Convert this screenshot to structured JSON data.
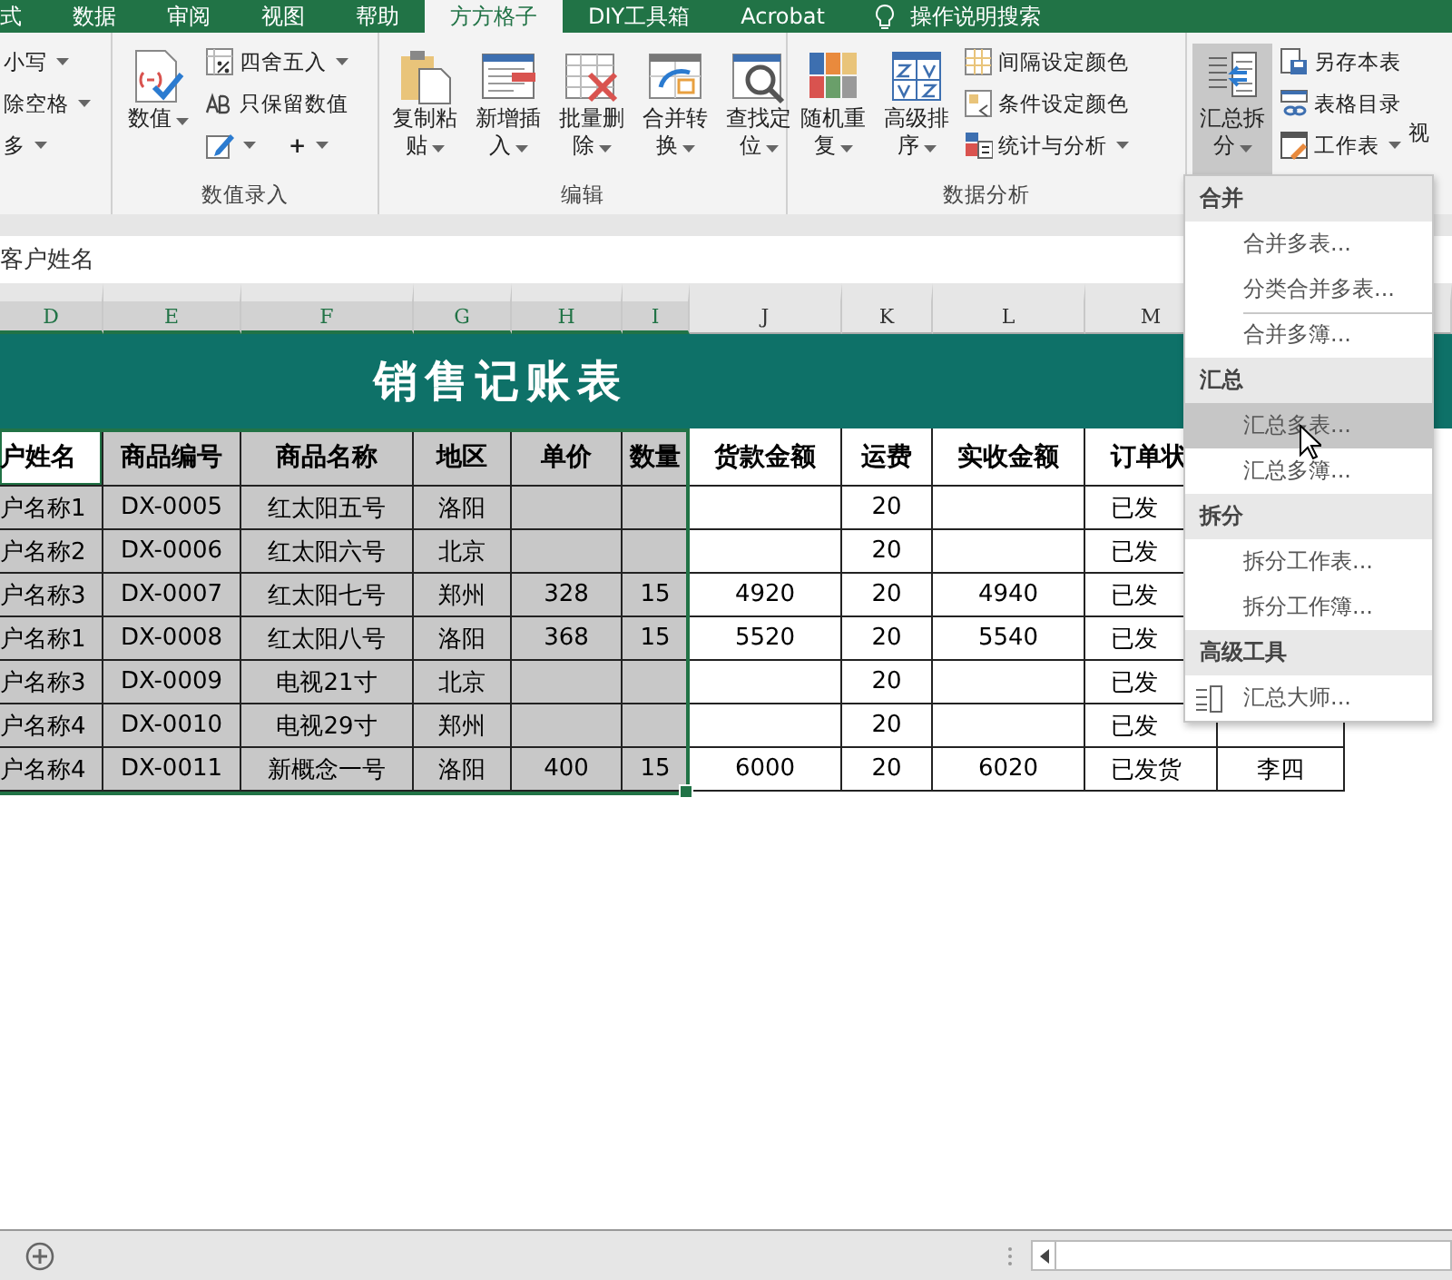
{
  "ribbon_tabs": [
    {
      "label": "式",
      "selected": false
    },
    {
      "label": "数据",
      "selected": false
    },
    {
      "label": "审阅",
      "selected": false
    },
    {
      "label": "视图",
      "selected": false
    },
    {
      "label": "帮助",
      "selected": false
    },
    {
      "label": "方方格子",
      "selected": true
    },
    {
      "label": "DIY工具箱",
      "selected": false
    },
    {
      "label": "Acrobat",
      "selected": false
    }
  ],
  "tell_me": "操作说明搜索",
  "ribbon": {
    "partial_group": {
      "items": [
        "小写",
        "除空格",
        "多"
      ]
    },
    "number_entry": {
      "label": "数值录入",
      "big": "数值",
      "small": [
        {
          "label": "四舍五入",
          "dropdown": true
        },
        {
          "label": "只保留数值",
          "dropdown": false
        }
      ],
      "plus": "+"
    },
    "edit": {
      "label": "编辑",
      "buttons": [
        "复制粘贴",
        "新增插入",
        "批量删除",
        "合并转换",
        "查找定位"
      ]
    },
    "analysis": {
      "label": "数据分析",
      "buttons": [
        "随机重复",
        "高级排序"
      ],
      "small": [
        {
          "label": "间隔设定颜色",
          "dropdown": false
        },
        {
          "label": "条件设定颜色",
          "dropdown": false
        },
        {
          "label": "统计与分析",
          "dropdown": true
        }
      ]
    },
    "summary": {
      "big": {
        "label": "汇总拆分",
        "pressed": true
      },
      "small": [
        {
          "label": "另存本表",
          "dropdown": false
        },
        {
          "label": "表格目录",
          "dropdown": false
        },
        {
          "label": "工作表",
          "dropdown": true
        }
      ]
    },
    "cut_tab": "视"
  },
  "formula_bar": {
    "value": "客户姓名"
  },
  "columns": [
    {
      "letter": "D",
      "selected": true
    },
    {
      "letter": "E",
      "selected": true
    },
    {
      "letter": "F",
      "selected": true
    },
    {
      "letter": "G",
      "selected": true
    },
    {
      "letter": "H",
      "selected": true
    },
    {
      "letter": "I",
      "selected": true
    },
    {
      "letter": "J",
      "selected": false
    },
    {
      "letter": "K",
      "selected": false
    },
    {
      "letter": "L",
      "selected": false
    },
    {
      "letter": "M",
      "selected": false
    }
  ],
  "sheet_title": "销售记账表",
  "table": {
    "headers": [
      {
        "text": "户姓名",
        "active": true
      },
      {
        "text": "商品编号",
        "active": false
      },
      {
        "text": "商品名称",
        "active": false
      },
      {
        "text": "地区",
        "active": false
      },
      {
        "text": "单价",
        "active": false
      },
      {
        "text": "数量",
        "active": false
      },
      {
        "text": "货款金额",
        "active": false
      },
      {
        "text": "运费",
        "active": false
      },
      {
        "text": "实收金额",
        "active": false
      },
      {
        "text": "订单状",
        "active": false
      }
    ],
    "rows": [
      [
        "户名称1",
        "DX-0005",
        "红太阳五号",
        "洛阳",
        null,
        null,
        null,
        "20",
        null,
        "已发",
        null
      ],
      [
        "户名称2",
        "DX-0006",
        "红太阳六号",
        "北京",
        null,
        null,
        null,
        "20",
        null,
        "已发",
        null
      ],
      [
        "户名称3",
        "DX-0007",
        "红太阳七号",
        "郑州",
        "328",
        "15",
        "4920",
        "20",
        "4940",
        "已发",
        null
      ],
      [
        "户名称1",
        "DX-0008",
        "红太阳八号",
        "洛阳",
        "368",
        "15",
        "5520",
        "20",
        "5540",
        "已发",
        null
      ],
      [
        "户名称3",
        "DX-0009",
        "电视21寸",
        "北京",
        null,
        null,
        null,
        "20",
        null,
        "已发",
        null
      ],
      [
        "户名称4",
        "DX-0010",
        "电视29寸",
        "郑州",
        null,
        null,
        null,
        "20",
        null,
        "已发",
        null
      ],
      [
        "户名称4",
        "DX-0011",
        "新概念一号",
        "洛阳",
        "400",
        "15",
        "6000",
        "20",
        "6020",
        "已发货",
        "李四"
      ]
    ]
  },
  "dropdown_menu": {
    "sections": [
      {
        "title": "合并",
        "items": [
          {
            "label": "合并多表...",
            "highlighted": false,
            "separator_before": false,
            "has_icon": false
          },
          {
            "label": "分类合并多表...",
            "highlighted": false,
            "separator_before": false,
            "has_icon": false
          },
          {
            "label": "合并多簿...",
            "highlighted": false,
            "separator_before": true,
            "has_icon": false
          }
        ]
      },
      {
        "title": "汇总",
        "items": [
          {
            "label": "汇总多表...",
            "highlighted": true,
            "separator_before": false,
            "has_icon": false
          },
          {
            "label": "汇总多簿...",
            "highlighted": false,
            "separator_before": false,
            "has_icon": false
          }
        ]
      },
      {
        "title": "拆分",
        "items": [
          {
            "label": "拆分工作表...",
            "highlighted": false,
            "separator_before": false,
            "has_icon": false
          },
          {
            "label": "拆分工作簿...",
            "highlighted": false,
            "separator_before": false,
            "has_icon": false
          }
        ]
      },
      {
        "title": "高级工具",
        "items": [
          {
            "label": "汇总大师...",
            "highlighted": false,
            "separator_before": false,
            "has_icon": true
          }
        ]
      }
    ]
  }
}
